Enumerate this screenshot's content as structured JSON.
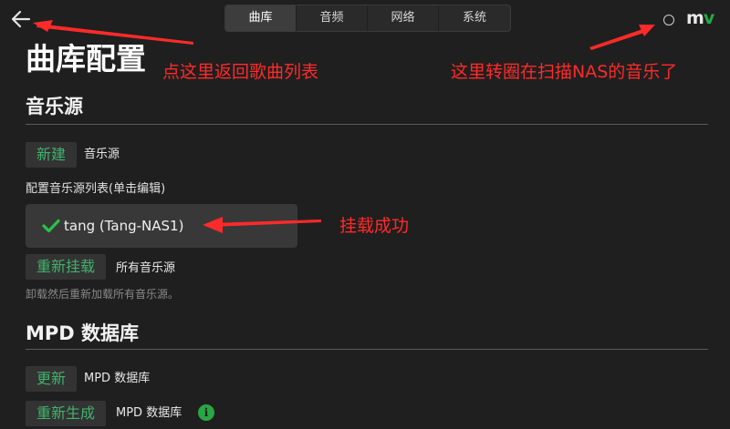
{
  "nav": {
    "tabs": [
      {
        "label": "曲库"
      },
      {
        "label": "音频"
      },
      {
        "label": "网络"
      },
      {
        "label": "系统"
      }
    ],
    "active_tab": "曲库",
    "logo_m": "m",
    "logo_v": "v"
  },
  "page": {
    "title": "曲库配置"
  },
  "music_sources": {
    "heading": "音乐源",
    "new_button": "新建",
    "new_suffix": "音乐源",
    "list_label": "配置音乐源列表(单击编辑)",
    "sources": [
      {
        "name": "tang (Tang-NAS1)",
        "status": "mounted"
      }
    ],
    "remount_button": "重新挂载",
    "remount_suffix": "所有音乐源",
    "remount_hint": "卸载然后重新加载所有音乐源。"
  },
  "mpd": {
    "heading": "MPD 数据库",
    "update_button": "更新",
    "update_suffix": "MPD 数据库",
    "rebuild_button": "重新生成",
    "rebuild_suffix": "MPD 数据库"
  },
  "annotations": {
    "back": "点这里返回歌曲列表",
    "spinner": "这里转圈在扫描NAS的音乐了",
    "mounted": "挂载成功"
  },
  "colors": {
    "background": "#1f1f1f",
    "accent_green": "#3fb36b",
    "annotation_red": "#ff2a2a"
  }
}
